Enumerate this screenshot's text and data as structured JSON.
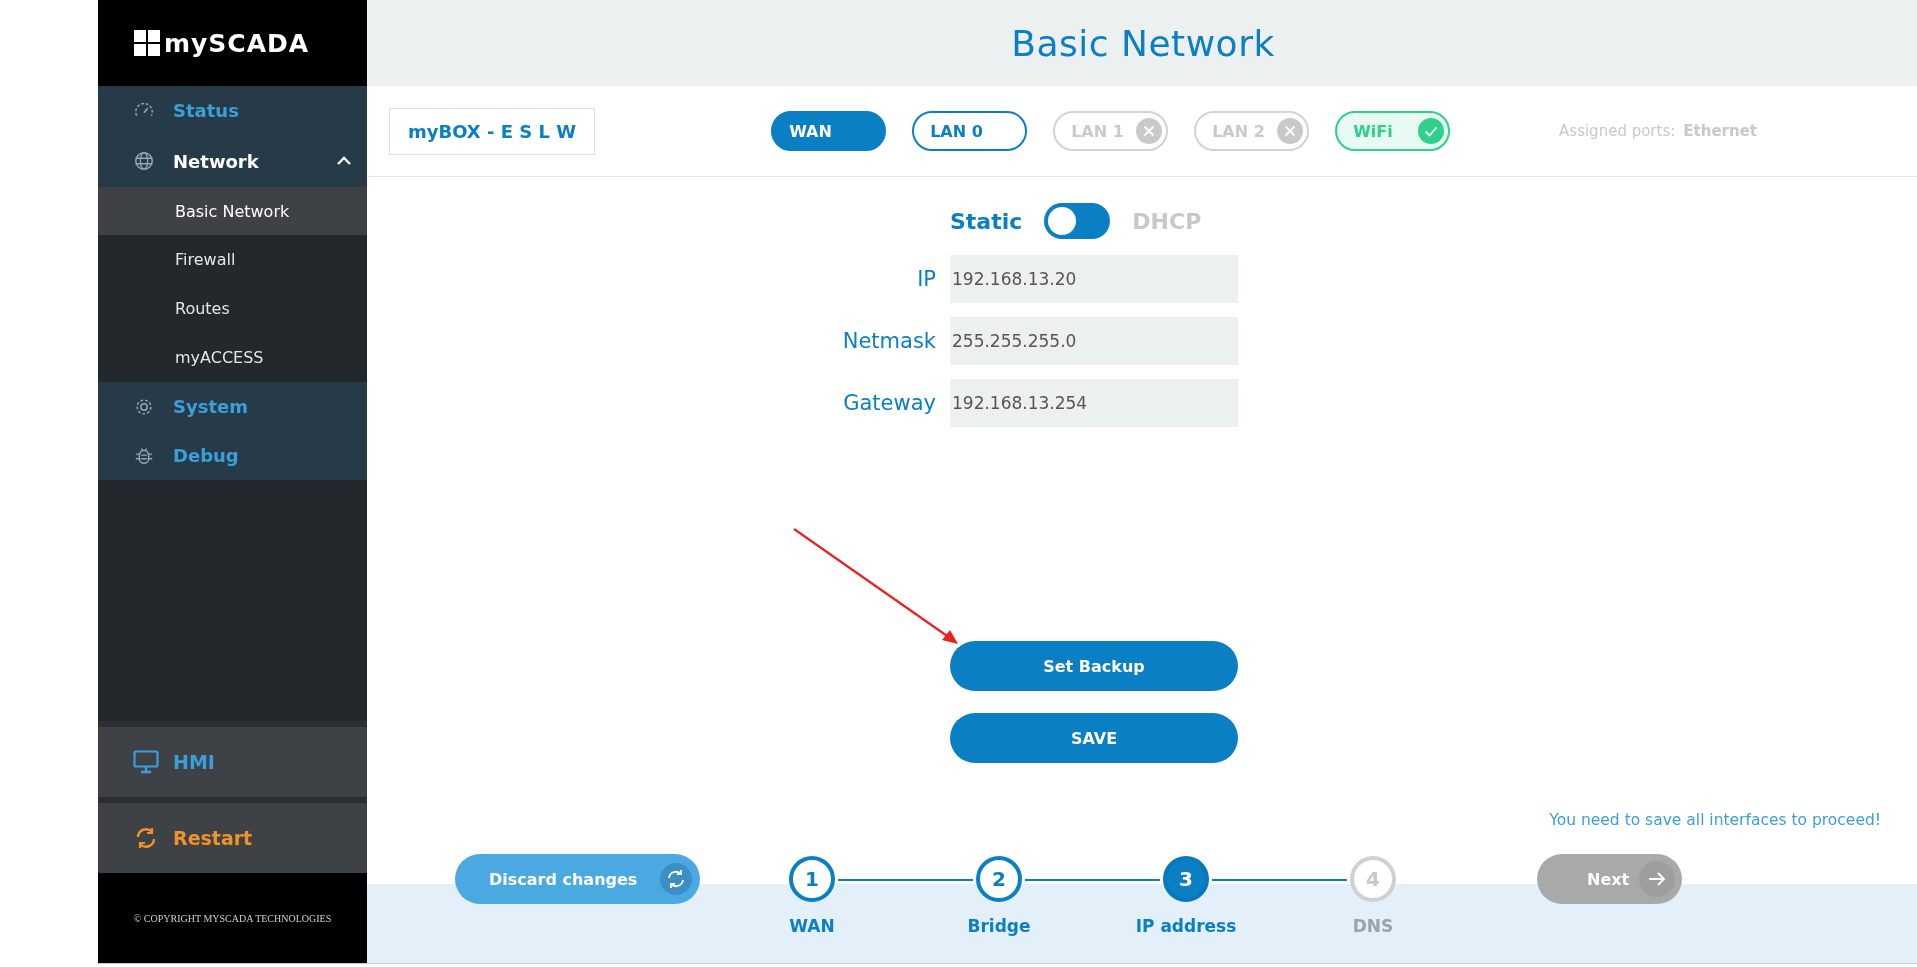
{
  "sidebar": {
    "logo": "mySCADA",
    "items": [
      {
        "label": "Status",
        "expanded": false
      },
      {
        "label": "Network",
        "expanded": true,
        "children": [
          {
            "label": "Basic Network",
            "selected": true
          },
          {
            "label": "Firewall",
            "selected": false
          },
          {
            "label": "Routes",
            "selected": false
          },
          {
            "label": "myACCESS",
            "selected": false
          }
        ]
      },
      {
        "label": "System",
        "expanded": false
      },
      {
        "label": "Debug",
        "expanded": false
      }
    ],
    "actions": [
      {
        "label": "HMI",
        "kind": "hmi"
      },
      {
        "label": "Restart",
        "kind": "restart"
      }
    ],
    "copyright": "© COPYRIGHT MYSCADA TECHNOLOGIES"
  },
  "page_title": "Basic Network",
  "device": "myBOX - E S L W",
  "interfaces": [
    {
      "label": "WAN",
      "selected": true,
      "kind": "plain"
    },
    {
      "label": "LAN 0",
      "selected": false,
      "kind": "plain"
    },
    {
      "label": "LAN 1",
      "selected": false,
      "kind": "off"
    },
    {
      "label": "LAN 2",
      "selected": false,
      "kind": "off"
    },
    {
      "label": "WiFi",
      "selected": false,
      "kind": "on"
    }
  ],
  "assigned_ports": {
    "label": "Assigned ports:",
    "value": "Ethernet"
  },
  "mode": {
    "left": "Static",
    "right": "DHCP",
    "on": false
  },
  "fields": [
    {
      "label": "IP",
      "value": "192.168.13.20"
    },
    {
      "label": "Netmask",
      "value": "255.255.255.0"
    },
    {
      "label": "Gateway",
      "value": "192.168.13.254"
    }
  ],
  "buttons": [
    "Set Backup",
    "SAVE"
  ],
  "message": "You need to save all interfaces to proceed!",
  "discard": "Discard changes",
  "steps": [
    {
      "number": "1",
      "label": "WAN",
      "done": true,
      "selected": false
    },
    {
      "number": "2",
      "label": "Bridge",
      "done": true,
      "selected": false
    },
    {
      "number": "3",
      "label": "IP address",
      "done": false,
      "selected": true
    },
    {
      "number": "4",
      "label": "DNS",
      "done": false,
      "selected": false
    }
  ],
  "next": {
    "label": "Next",
    "disabled": true
  }
}
